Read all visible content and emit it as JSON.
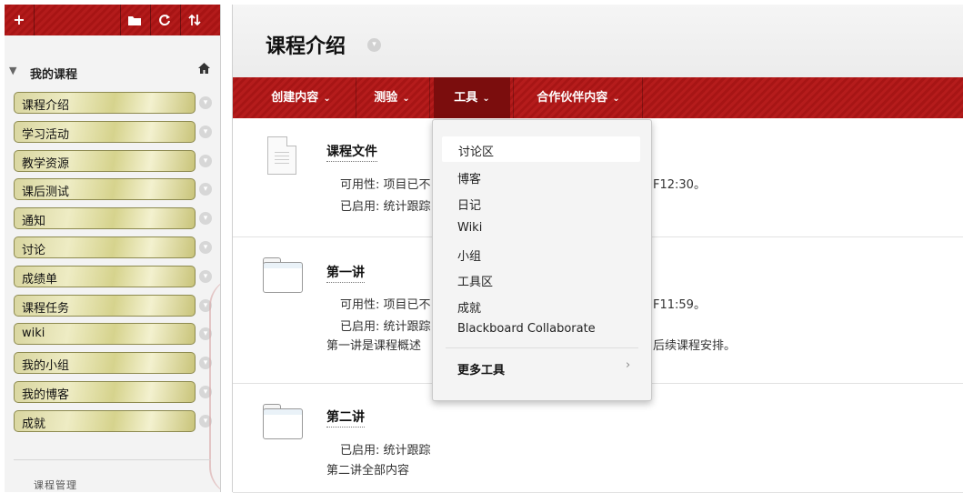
{
  "sidebar": {
    "toolbar": {
      "add": "+",
      "folder_icon": "folder-icon",
      "refresh_icon": "refresh-icon",
      "sort_icon": "sort-icon"
    },
    "course_header": "我的课程",
    "items": [
      "课程介绍",
      "学习活动",
      "教学资源",
      "课后测试",
      "通知",
      "讨论",
      "成绩单",
      "课程任务",
      "wiki",
      "我的小组",
      "我的博客",
      "成就"
    ],
    "admin_label": "课程管理"
  },
  "page": {
    "title": "课程介绍"
  },
  "actions": [
    {
      "label": "创建内容"
    },
    {
      "label": "测验"
    },
    {
      "label": "工具"
    },
    {
      "label": "合作伙伴内容"
    }
  ],
  "content": [
    {
      "title": "课程文件",
      "icon": "document-icon",
      "lines": [
        {
          "left": "可用性:  项目已不",
          "right": "F12:30。"
        },
        {
          "left": "已启用:  统计跟踪",
          "right": ""
        }
      ]
    },
    {
      "title": "第一讲",
      "icon": "folder-icon",
      "lines": [
        {
          "left": "可用性:  项目已不",
          "right": "F11:59。"
        },
        {
          "left": "已启用:  统计跟踪",
          "right": ""
        },
        {
          "left": "第一讲是课程概述",
          "right": "后续课程安排。"
        }
      ]
    },
    {
      "title": "第二讲",
      "icon": "folder-icon",
      "lines": [
        {
          "left": "已启用:  统计跟踪",
          "right": ""
        },
        {
          "left": "第二讲全部内容",
          "right": ""
        }
      ]
    }
  ],
  "tools_menu": {
    "items": [
      "讨论区",
      "博客",
      "日记",
      "Wiki",
      "小组",
      "工具区",
      "成就",
      "Blackboard Collaborate"
    ],
    "more": "更多工具",
    "highlighted": "讨论区"
  }
}
